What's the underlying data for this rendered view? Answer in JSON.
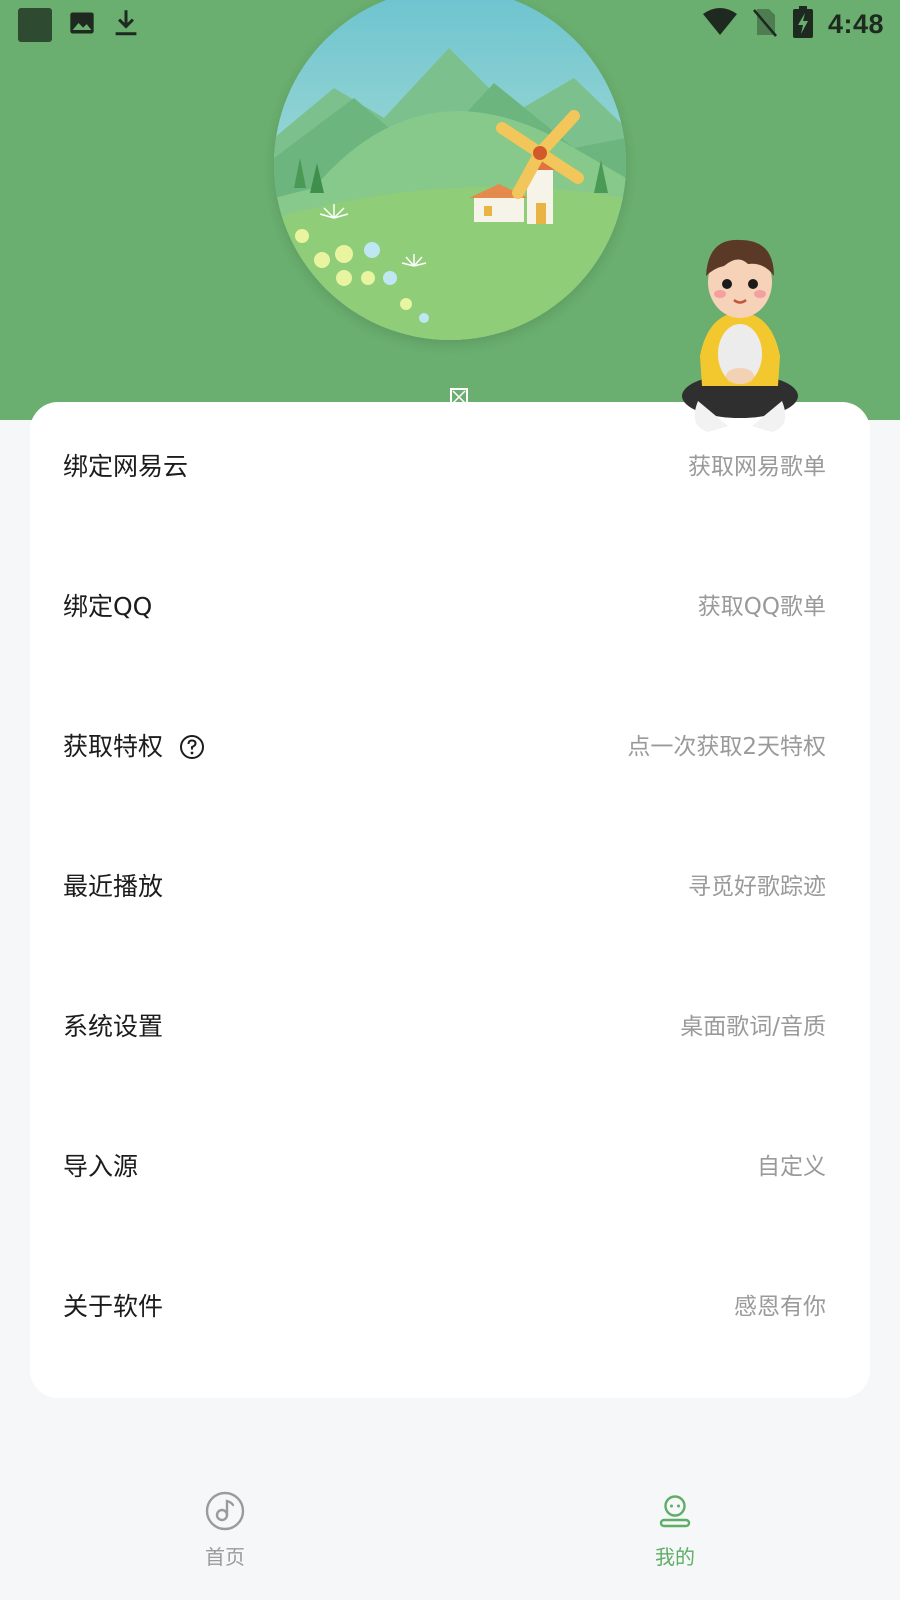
{
  "status_bar": {
    "time": "4:48",
    "left_icons": [
      "app-square-icon",
      "image-icon",
      "download-icon"
    ],
    "right_icons": [
      "wifi-icon",
      "no-sim-icon",
      "battery-charging-icon"
    ]
  },
  "menu": {
    "items": [
      {
        "label": "绑定网易云",
        "hint": "获取网易歌单"
      },
      {
        "label": "绑定QQ",
        "hint": "获取QQ歌单"
      },
      {
        "label": "获取特权",
        "hint": "点一次获取2天特权",
        "icon": "help-circle-icon"
      },
      {
        "label": "最近播放",
        "hint": "寻觅好歌踪迹"
      },
      {
        "label": "系统设置",
        "hint": "桌面歌词/音质"
      },
      {
        "label": "导入源",
        "hint": "自定义"
      },
      {
        "label": "关于软件",
        "hint": "感恩有你"
      }
    ]
  },
  "bottom_nav": {
    "items": [
      {
        "label": "首页",
        "icon": "music-disc-icon",
        "active": false
      },
      {
        "label": "我的",
        "icon": "user-profile-icon",
        "active": true
      }
    ]
  },
  "colors": {
    "header_green": "#6aaf6f",
    "active_green": "#5fae66",
    "inactive_gray": "#9b9b9b",
    "hint_gray": "#9a9a9a",
    "page_bg": "#f6f7f9"
  }
}
